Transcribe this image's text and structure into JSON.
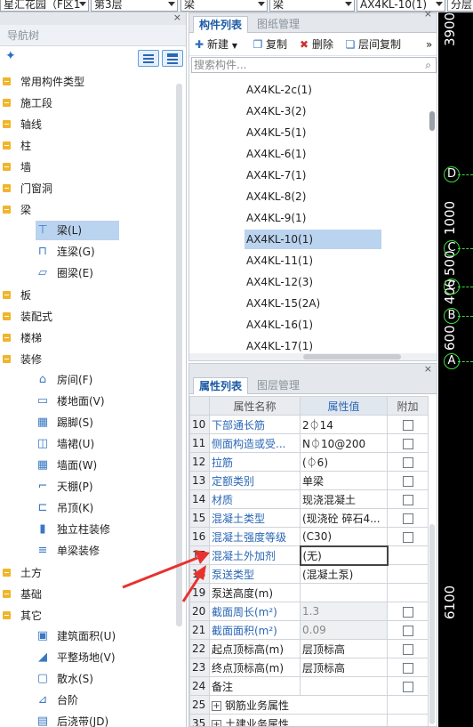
{
  "toolbar": {
    "project_combo": "星汇花园（F区1",
    "floor_combo": "第3层",
    "category_combo": "梁",
    "type_combo": "梁",
    "component_combo": "AX4KL-10(1)",
    "extra_combo": "分层"
  },
  "nav": {
    "title": "导航树",
    "close_glyph": "×",
    "items": [
      {
        "label": "常用构件类型"
      },
      {
        "label": "施工段"
      },
      {
        "label": "轴线"
      },
      {
        "label": "柱"
      },
      {
        "label": "墙"
      },
      {
        "label": "门窗洞"
      },
      {
        "label": "梁",
        "children": [
          {
            "label": "梁(L)",
            "icon": "beam-icon",
            "selected": true
          },
          {
            "label": "连梁(G)",
            "icon": "coupling-beam-icon"
          },
          {
            "label": "圈梁(E)",
            "icon": "ring-beam-icon"
          }
        ]
      },
      {
        "label": "板"
      },
      {
        "label": "装配式"
      },
      {
        "label": "楼梯"
      },
      {
        "label": "装修",
        "children": [
          {
            "label": "房间(F)",
            "icon": "room-icon"
          },
          {
            "label": "楼地面(V)",
            "icon": "floor-icon"
          },
          {
            "label": "踢脚(S)",
            "icon": "skirting-icon"
          },
          {
            "label": "墙裙(U)",
            "icon": "dado-icon"
          },
          {
            "label": "墙面(W)",
            "icon": "wall-face-icon"
          },
          {
            "label": "天棚(P)",
            "icon": "ceiling-icon"
          },
          {
            "label": "吊顶(K)",
            "icon": "suspended-ceiling-icon"
          },
          {
            "label": "独立柱装修",
            "icon": "column-finish-icon"
          },
          {
            "label": "单梁装修",
            "icon": "beam-finish-icon"
          }
        ]
      },
      {
        "label": "土方"
      },
      {
        "label": "基础"
      },
      {
        "label": "其它",
        "children": [
          {
            "label": "建筑面积(U)",
            "icon": "building-area-icon"
          },
          {
            "label": "平整场地(V)",
            "icon": "site-leveling-icon"
          },
          {
            "label": "散水(S)",
            "icon": "apron-icon"
          },
          {
            "label": "台阶",
            "icon": "steps-icon"
          },
          {
            "label": "后浇带(JD)",
            "icon": "post-cast-strip-icon"
          }
        ]
      }
    ]
  },
  "components": {
    "tabs": [
      "构件列表",
      "图纸管理"
    ],
    "close_glyph": "×",
    "tools": {
      "new": "新建",
      "copy": "复制",
      "delete": "删除",
      "floor_copy": "层间复制",
      "more": "»"
    },
    "search_placeholder": "搜索构件...",
    "items": [
      {
        "label": "AX4KL-2c(1)"
      },
      {
        "label": "AX4KL-3(2)"
      },
      {
        "label": "AX4KL-5(1)"
      },
      {
        "label": "AX4KL-6(1)"
      },
      {
        "label": "AX4KL-7(1)"
      },
      {
        "label": "AX4KL-8(2)"
      },
      {
        "label": "AX4KL-9(1)"
      },
      {
        "label": "AX4KL-10(1)",
        "selected": true
      },
      {
        "label": "AX4KL-11(1)"
      },
      {
        "label": "AX4KL-12(3)"
      },
      {
        "label": "AX4KL-15(2A)"
      },
      {
        "label": "AX4KL-16(1)"
      },
      {
        "label": "AX4KL-17(1)"
      }
    ]
  },
  "properties": {
    "tabs": [
      "属性列表",
      "图层管理"
    ],
    "close_glyph": "×",
    "headers": {
      "name": "属性名称",
      "value": "属性值",
      "extra": "附加"
    },
    "rows": [
      {
        "num": "10",
        "name": "下部通长筋",
        "value": "2⏀14",
        "blue": true,
        "checkbox": true
      },
      {
        "num": "11",
        "name": "侧面构造或受...",
        "value": "N⏀10@200",
        "blue": true,
        "checkbox": true
      },
      {
        "num": "12",
        "name": "拉筋",
        "value": "(⏀6)",
        "blue": true,
        "checkbox": true
      },
      {
        "num": "13",
        "name": "定额类别",
        "value": "单梁",
        "blue": true,
        "checkbox": true
      },
      {
        "num": "14",
        "name": "材质",
        "value": "现浇混凝土",
        "blue": true,
        "checkbox": true
      },
      {
        "num": "15",
        "name": "混凝土类型",
        "value": "(现浇砼 碎石4...",
        "blue": true,
        "checkbox": true
      },
      {
        "num": "16",
        "name": "混凝土强度等级",
        "value": "(C30)",
        "blue": true,
        "checkbox": true
      },
      {
        "num": "17",
        "name": "混凝土外加剂",
        "value": "(无)",
        "blue": true,
        "checkbox": false,
        "editing": true
      },
      {
        "num": "18",
        "name": "泵送类型",
        "value": "(混凝土泵)",
        "blue": true,
        "checkbox": false
      },
      {
        "num": "19",
        "name": "泵送高度(m)",
        "value": "",
        "blue": false,
        "checkbox": false
      },
      {
        "num": "20",
        "name": "截面周长(m²)",
        "value": "1.3",
        "blue": true,
        "checkbox": true,
        "gray": true
      },
      {
        "num": "21",
        "name": "截面面积(m²)",
        "value": "0.09",
        "blue": true,
        "checkbox": true,
        "gray": true
      },
      {
        "num": "22",
        "name": "起点顶标高(m)",
        "value": "层顶标高",
        "blue": false,
        "checkbox": true
      },
      {
        "num": "23",
        "name": "终点顶标高(m)",
        "value": "层顶标高",
        "blue": false,
        "checkbox": true
      },
      {
        "num": "24",
        "name": "备注",
        "value": "",
        "blue": false,
        "checkbox": true
      },
      {
        "num": "25",
        "name": "钢筋业务属性",
        "value": "",
        "blue": false,
        "checkbox": false,
        "group": true
      },
      {
        "num": "35",
        "name": "土建业务属性",
        "value": "",
        "blue": false,
        "checkbox": false,
        "group": true
      }
    ]
  },
  "canvas": {
    "dimensions": [
      "3900",
      "1000",
      "400",
      "500",
      "600",
      "6100"
    ],
    "axes": [
      "D",
      "C",
      "C",
      "B",
      "A"
    ],
    "colors": {
      "background": "#000000",
      "axis": "#3fdc3f",
      "text": "#ffffff"
    }
  },
  "colors": {
    "accent": "#2a67b5",
    "selection": "#bad3ef",
    "annotation_arrow": "#e8322e"
  }
}
